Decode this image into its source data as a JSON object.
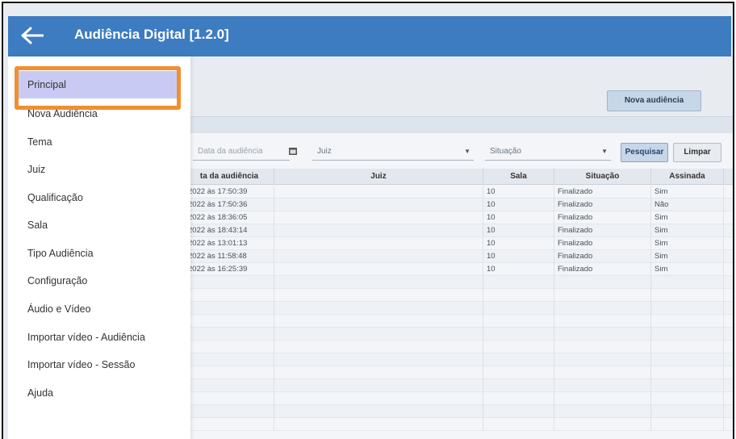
{
  "app": {
    "title": "Audiência Digital [1.2.0]",
    "accent": "#3d7cc0"
  },
  "toolbar": {
    "new_hearing_label": "Nova audiência"
  },
  "filters": {
    "date_placeholder": "Data da audiência",
    "judge_value": "Juiz",
    "status_value": "Situação",
    "search_label": "Pesquisar",
    "clear_label": "Limpar"
  },
  "table": {
    "headers": [
      "ta da audiência",
      "Juiz",
      "Sala",
      "Situação",
      "Assinada"
    ],
    "rows": [
      {
        "date": "2022 às 17:50:39",
        "judge": "",
        "room": "10",
        "status": "Finalizado",
        "signed": "Sim"
      },
      {
        "date": "2022 às 17:50:36",
        "judge": "",
        "room": "10",
        "status": "Finalizado",
        "signed": "Não"
      },
      {
        "date": "2022 às 18:36:05",
        "judge": "",
        "room": "10",
        "status": "Finalizado",
        "signed": "Sim"
      },
      {
        "date": "2022 às 18:43:14",
        "judge": "",
        "room": "10",
        "status": "Finalizado",
        "signed": "Sim"
      },
      {
        "date": "2022 às 13:01:13",
        "judge": "",
        "room": "10",
        "status": "Finalizado",
        "signed": "Sim"
      },
      {
        "date": "2022 às 11:58:48",
        "judge": "",
        "room": "10",
        "status": "Finalizado",
        "signed": "Sim"
      },
      {
        "date": "2022 às 16:25:39",
        "judge": "",
        "room": "10",
        "status": "Finalizado",
        "signed": "Sim"
      }
    ]
  },
  "menu": {
    "items": [
      {
        "label": "Principal"
      },
      {
        "label": "Nova Audiência"
      },
      {
        "label": "Tema"
      },
      {
        "label": "Juiz"
      },
      {
        "label": "Qualificação"
      },
      {
        "label": "Sala"
      },
      {
        "label": "Tipo Audiência"
      },
      {
        "label": "Configuração"
      },
      {
        "label": "Áudio e Vídeo"
      },
      {
        "label": "Importar vídeo - Audiência"
      },
      {
        "label": "Importar vídeo - Sessão"
      },
      {
        "label": "Ajuda"
      }
    ],
    "active_index": 0,
    "highlight_color": "#f08f32"
  }
}
